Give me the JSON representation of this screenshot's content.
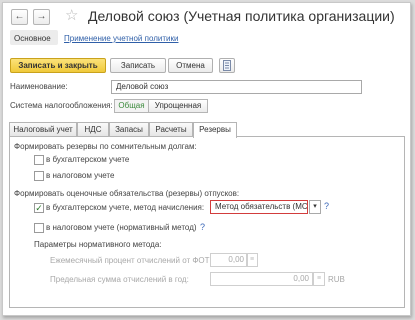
{
  "window": {
    "title": "Деловой союз (Учетная политика организации)"
  },
  "nav": {
    "back_icon": "arrow-left-icon",
    "forward_icon": "arrow-right-icon",
    "favorite_icon": "star-icon"
  },
  "top_tabs": {
    "main": "Основное",
    "apply": "Применение учетной политики"
  },
  "toolbar": {
    "save_close": "Записать и закрыть",
    "save": "Записать",
    "cancel": "Отмена"
  },
  "form": {
    "name_label": "Наименование:",
    "name_value": "Деловой союз",
    "tax_label": "Система налогообложения:",
    "tax_general": "Общая",
    "tax_simplified": "Упрощенная"
  },
  "tabs": [
    "Налоговый учет",
    "НДС",
    "Запасы",
    "Расчеты",
    "Резервы"
  ],
  "reserves": {
    "doubtful_heading": "Формировать резервы по сомнительным долгам:",
    "doubtful_accounting": "в бухгалтерском учете",
    "doubtful_tax": "в налоговом учете",
    "vacation_heading": "Формировать оценочные обязательства (резервы) отпусков:",
    "vacation_accounting": "в бухгалтерском учете, метод начисления:",
    "method_value": "Метод обязательств (МСФО)",
    "vacation_tax": "в налоговом учете (нормативный метод)",
    "q1": "?",
    "q2": "?",
    "params_heading": "Параметры нормативного метода:",
    "monthly_label": "Ежемесячный процент отчислений от ФОТ:",
    "monthly_value": "0,00",
    "max_label": "Предельная сумма отчислений в год:",
    "max_value": "0,00",
    "currency": "RUB"
  }
}
